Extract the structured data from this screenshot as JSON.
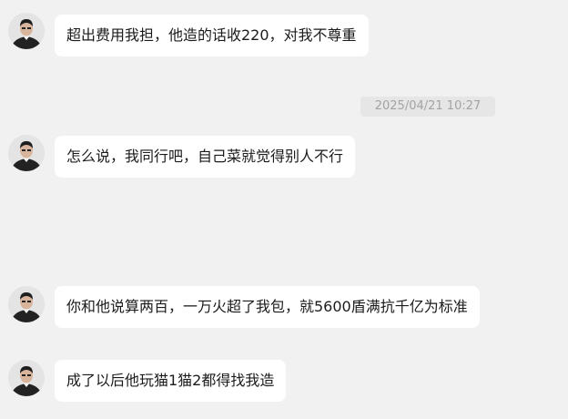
{
  "messages": [
    {
      "text": "超出费用我担，他造的话收220，对我不尊重",
      "avatar_icon": "user-avatar-icon"
    },
    {
      "text": "怎么说，我同行吧，自己菜就觉得别人不行",
      "avatar_icon": "user-avatar-icon"
    },
    {
      "text": "你和他说算两百，一万火超了我包，就5600盾满抗千亿为标准",
      "avatar_icon": "user-avatar-icon"
    },
    {
      "text": "成了以后他玩猫1猫2都得找我造",
      "avatar_icon": "user-avatar-icon"
    }
  ],
  "timestamp": "2025/04/21 10:27",
  "colors": {
    "background": "#f1f1f1",
    "bubble": "#ffffff",
    "text": "#1b1b1b",
    "timestamp_text": "#a3a3a3",
    "timestamp_bg": "#e6e6e6"
  }
}
